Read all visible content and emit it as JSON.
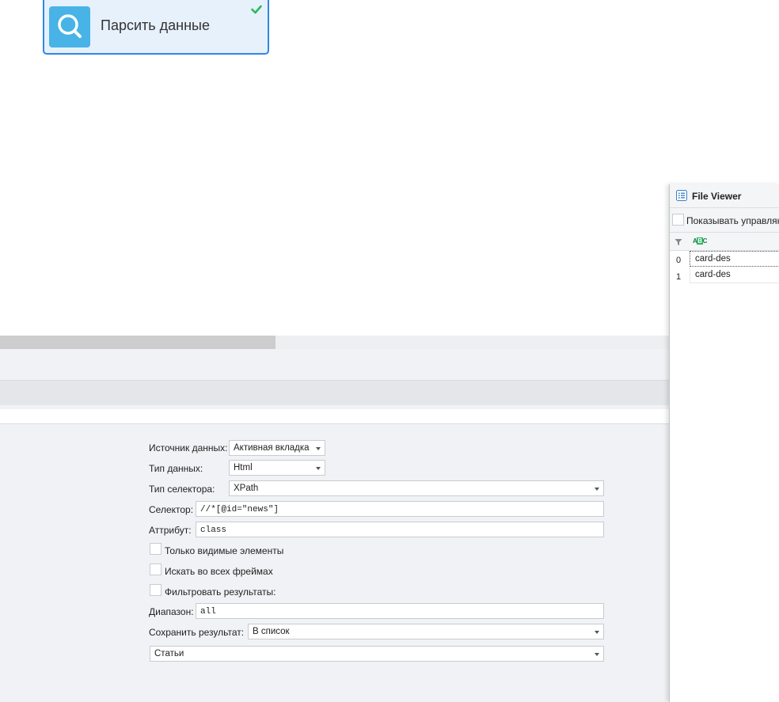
{
  "canvas": {
    "action_node": {
      "title": "Парсить данные",
      "icon": "magnifier-icon",
      "status_icon": "checkmark-icon",
      "status_color": "#2db85c",
      "accent_color": "#2f86e6"
    }
  },
  "properties": {
    "data_source": {
      "label": "Источник данных:",
      "value": "Активная вкладка"
    },
    "data_type": {
      "label": "Тип данных:",
      "value": "Html"
    },
    "selector_type": {
      "label": "Тип селектора:",
      "value": "XPath"
    },
    "selector": {
      "label": "Селектор:",
      "value": "//*[@id=\"news\"]"
    },
    "attribute": {
      "label": "Аттрибут:",
      "value": "class"
    },
    "only_visible": {
      "label": "Только видимые элементы",
      "checked": false
    },
    "search_frames": {
      "label": "Искать во всех фреймах",
      "checked": false
    },
    "filter_results": {
      "label": "Фильтровать результаты:",
      "checked": false
    },
    "range": {
      "label": "Диапазон:",
      "value": "all"
    },
    "save_result": {
      "label": "Сохранить результат:",
      "value": "В список"
    },
    "target_list": {
      "value": "Статьи"
    }
  },
  "file_viewer": {
    "title": "File Viewer",
    "show_control_label": "Показывать управляю",
    "column_type_icon": "abc-text-column-icon",
    "rows": [
      {
        "index": "0",
        "value": "card-des"
      },
      {
        "index": "1",
        "value": "card-des"
      }
    ]
  }
}
